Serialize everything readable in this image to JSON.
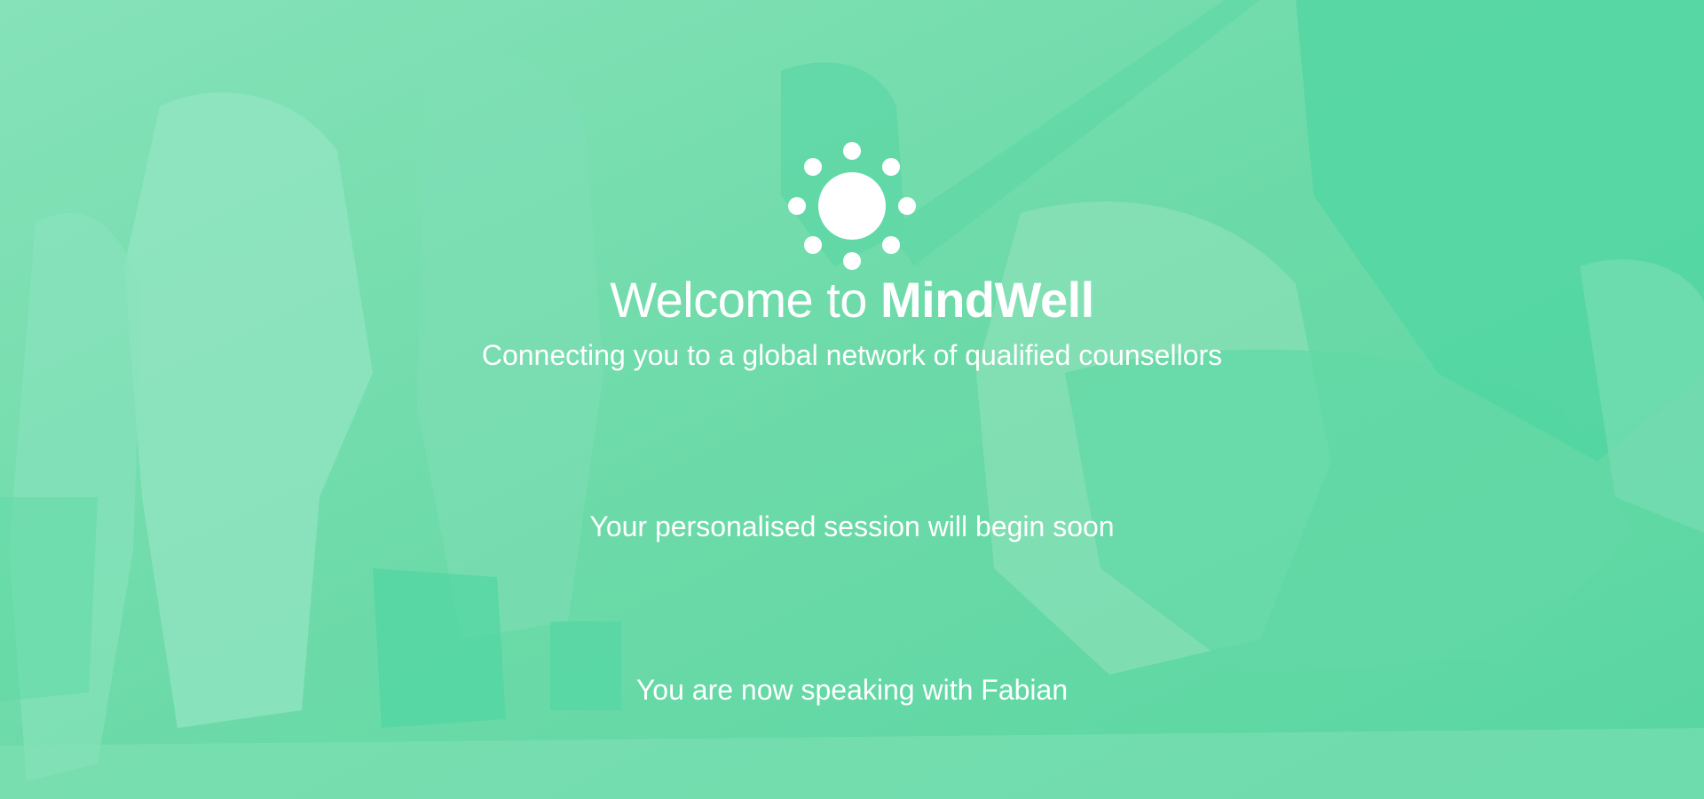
{
  "welcome": {
    "prefix": "Welcome to",
    "brand": "MindWell"
  },
  "tagline": "Connecting you to a global network of qualified counsellors",
  "session_status": "Your personalised session will begin soon",
  "counsellor_message": "You are now speaking with Fabian",
  "logo_icon": "sun-icon",
  "colors": {
    "accent_green": "#56d9a8",
    "text": "#ffffff"
  }
}
